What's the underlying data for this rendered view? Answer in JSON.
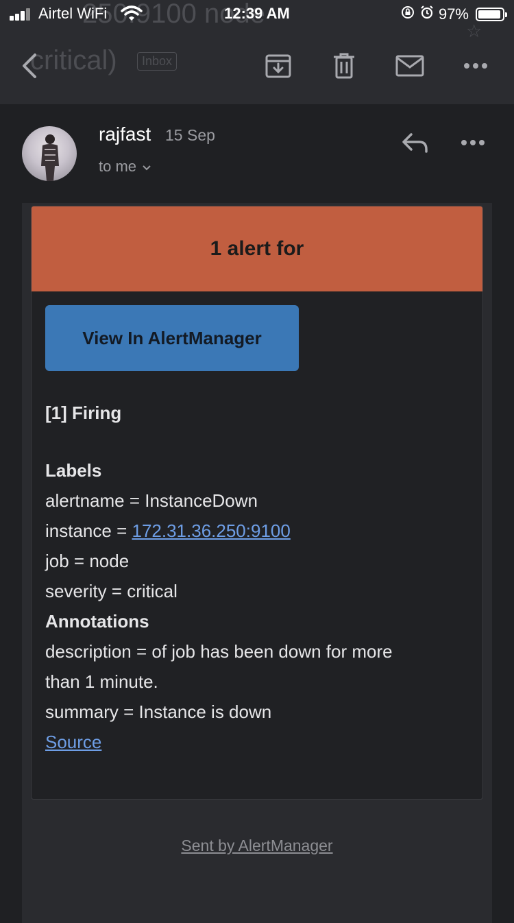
{
  "status_bar": {
    "carrier": "Airtel WiFi",
    "time": "12:39 AM",
    "battery": "97%"
  },
  "subject_ghost": {
    "line1": "250:9100 node",
    "line2": "critical)",
    "badge": "Inbox"
  },
  "nav": {
    "icons": [
      "back-icon",
      "archive-icon",
      "delete-icon",
      "mark-unread-icon",
      "more-icon"
    ]
  },
  "email": {
    "sender": "rajfast",
    "date": "15 Sep",
    "recipient": "to me"
  },
  "alert": {
    "header": "1 alert for",
    "button_label": "View In AlertManager",
    "firing": "[1] Firing",
    "labels_heading": "Labels",
    "alertname": "alertname = InstanceDown",
    "instance_prefix": "instance = ",
    "instance_link": "172.31.36.250:9100",
    "job": "job = node",
    "severity": "severity = critical",
    "annotations_heading": "Annotations",
    "description_1": "description = of job has been down for more",
    "description_2": "than 1 minute.",
    "summary": "summary = Instance is down",
    "source_link": "Source"
  },
  "footer": "Sent by AlertManager",
  "colors": {
    "header_bar": "#c15e40",
    "button": "#3b78b6",
    "link": "#6e9ee6",
    "background": "#1f2023"
  }
}
